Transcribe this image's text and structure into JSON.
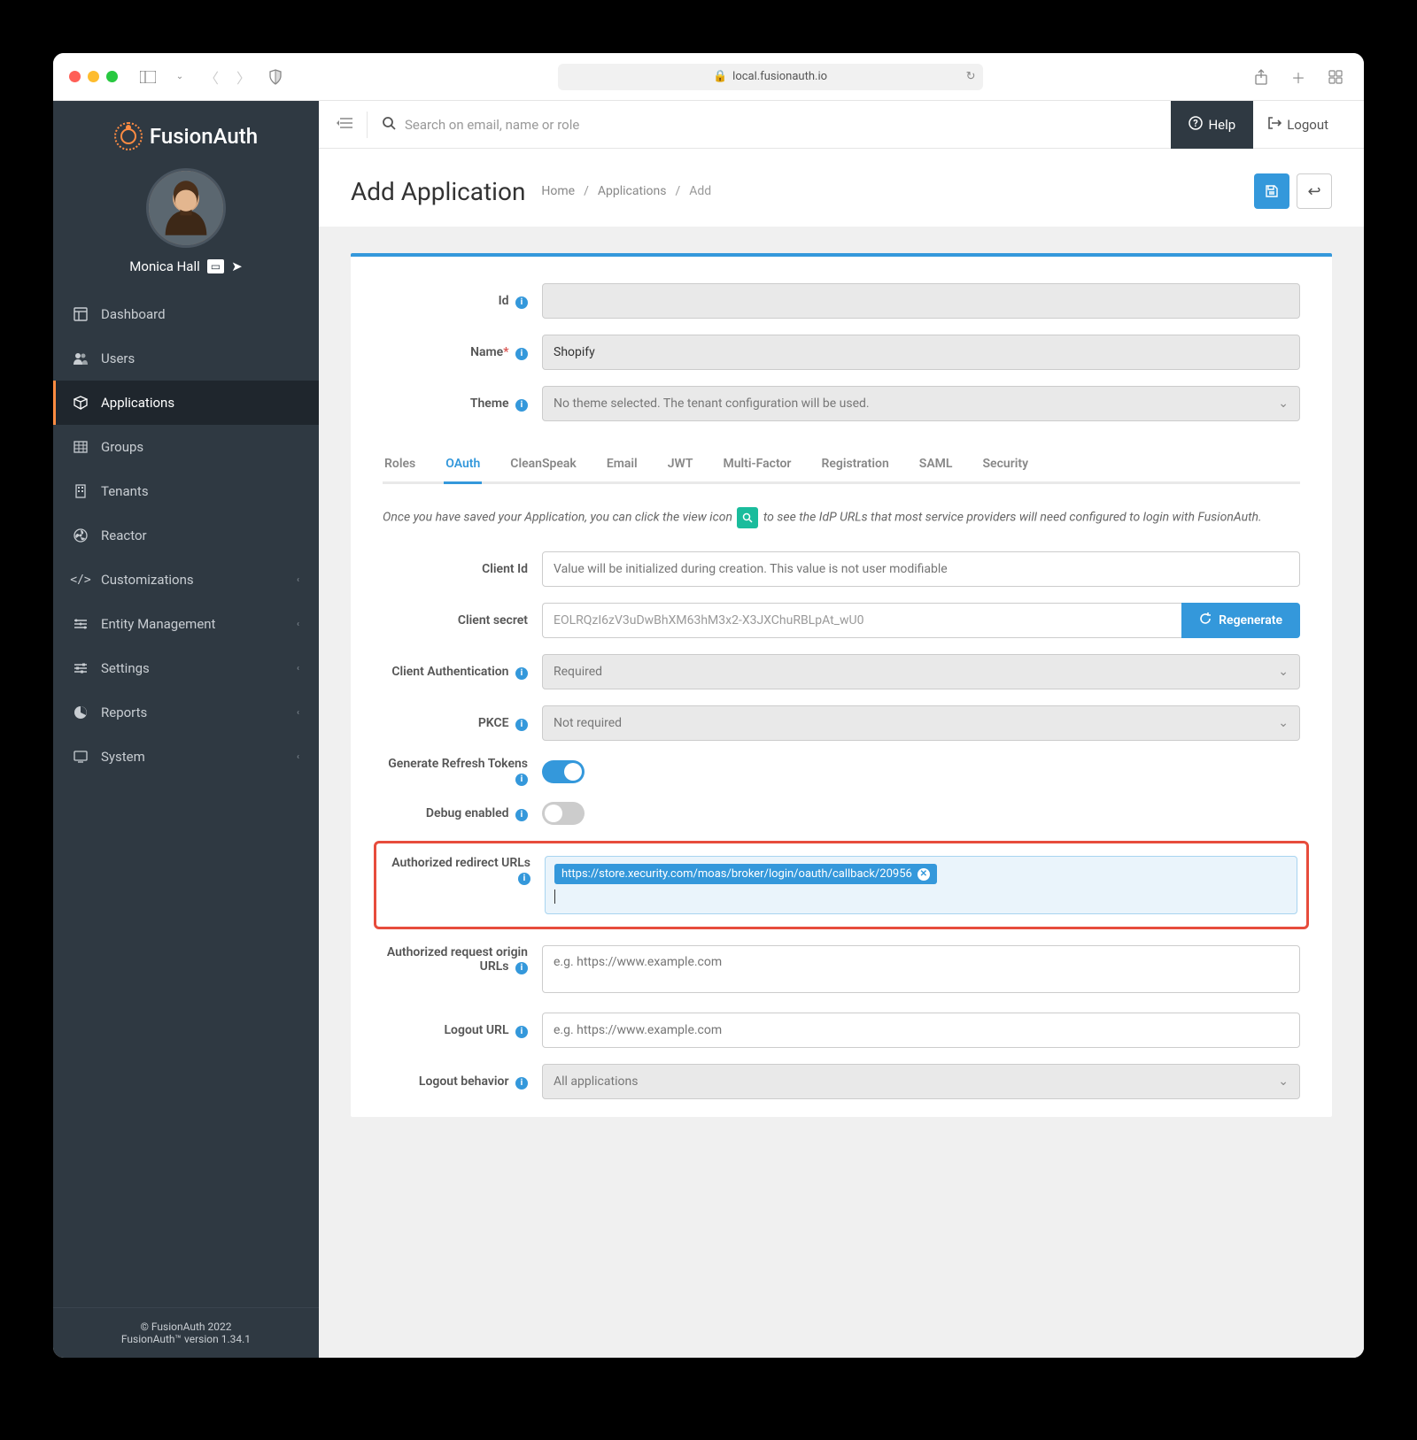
{
  "browser": {
    "url": "local.fusionauth.io"
  },
  "topbar": {
    "search_placeholder": "Search on email, name or role",
    "help_label": "Help",
    "logout_label": "Logout"
  },
  "sidebar": {
    "brand": "FusionAuth",
    "user_name": "Monica Hall",
    "items": [
      {
        "label": "Dashboard",
        "icon": "⬚"
      },
      {
        "label": "Users",
        "icon": "👥"
      },
      {
        "label": "Applications",
        "icon": "📦",
        "active": true
      },
      {
        "label": "Groups",
        "icon": "▦"
      },
      {
        "label": "Tenants",
        "icon": "🏢"
      },
      {
        "label": "Reactor",
        "icon": "☢"
      },
      {
        "label": "Customizations",
        "icon": "</>",
        "expandable": true
      },
      {
        "label": "Entity Management",
        "icon": "≡",
        "expandable": true
      },
      {
        "label": "Settings",
        "icon": "⚙",
        "expandable": true
      },
      {
        "label": "Reports",
        "icon": "◔",
        "expandable": true
      },
      {
        "label": "System",
        "icon": "🖥",
        "expandable": true
      }
    ],
    "footer_copyright": "© FusionAuth 2022",
    "footer_version": "FusionAuth™ version 1.34.1"
  },
  "page": {
    "title": "Add Application",
    "breadcrumb": [
      "Home",
      "Applications",
      "Add"
    ]
  },
  "form": {
    "id_label": "Id",
    "id_value": "",
    "name_label": "Name",
    "name_value": "Shopify",
    "theme_label": "Theme",
    "theme_value": "No theme selected. The tenant configuration will be used."
  },
  "tabs": [
    "Roles",
    "OAuth",
    "CleanSpeak",
    "Email",
    "JWT",
    "Multi-Factor",
    "Registration",
    "SAML",
    "Security"
  ],
  "active_tab": "OAuth",
  "oauth": {
    "help_text_1": "Once you have saved your Application, you can click the view icon",
    "help_text_2": "to see the IdP URLs that most service providers will need configured to login with FusionAuth.",
    "client_id_label": "Client Id",
    "client_id_placeholder": "Value will be initialized during creation. This value is not user modifiable",
    "client_secret_label": "Client secret",
    "client_secret_value": "EOLRQzI6zV3uDwBhXM63hM3x2-X3JXChuRBLpAt_wU0",
    "regenerate_label": "Regenerate",
    "client_auth_label": "Client Authentication",
    "client_auth_value": "Required",
    "pkce_label": "PKCE",
    "pkce_value": "Not required",
    "refresh_tokens_label": "Generate Refresh Tokens",
    "refresh_tokens_value": true,
    "debug_label": "Debug enabled",
    "debug_value": false,
    "redirect_urls_label": "Authorized redirect URLs",
    "redirect_urls_value": "https://store.xecurity.com/moas/broker/login/oauth/callback/20956",
    "origin_urls_label": "Authorized request origin URLs",
    "origin_urls_placeholder": "e.g. https://www.example.com",
    "logout_url_label": "Logout URL",
    "logout_url_placeholder": "e.g. https://www.example.com",
    "logout_behavior_label": "Logout behavior",
    "logout_behavior_value": "All applications"
  }
}
